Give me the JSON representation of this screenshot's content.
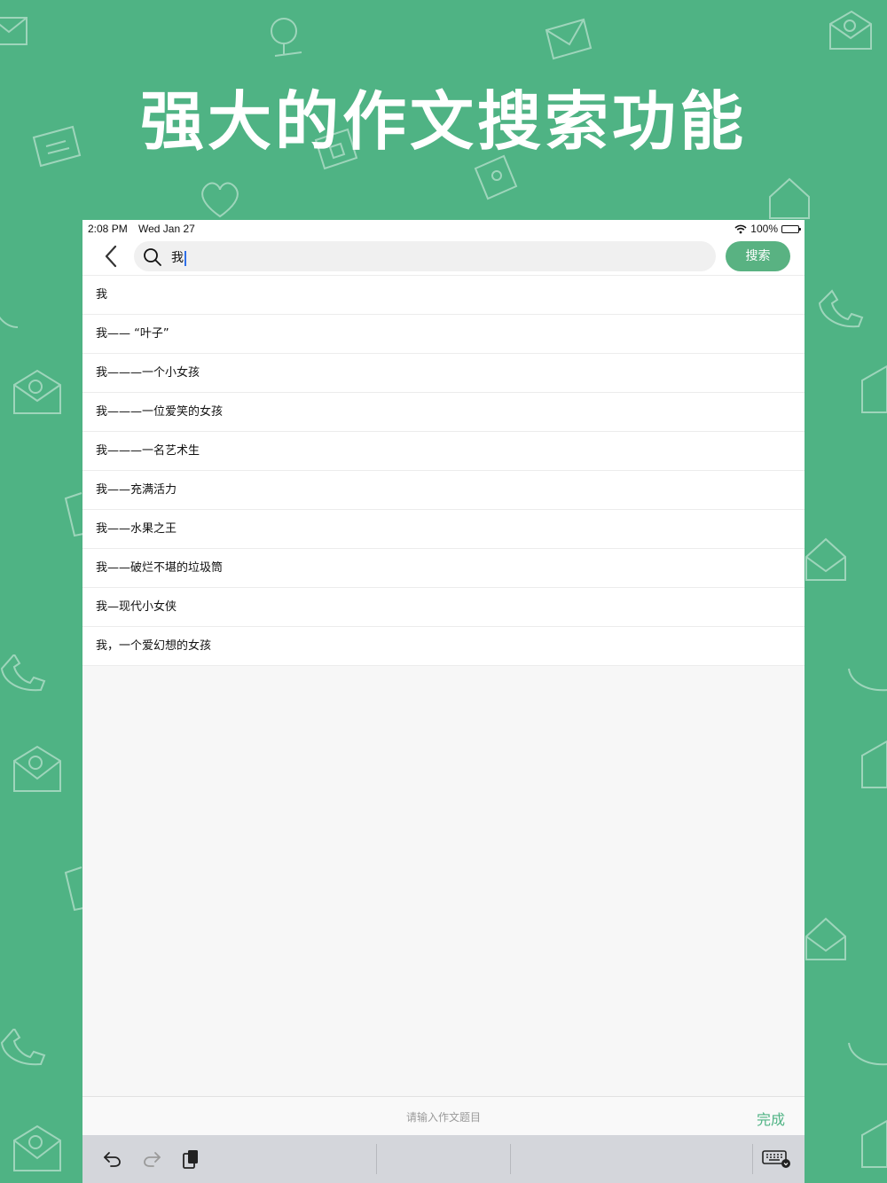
{
  "headline": "强大的作文搜索功能",
  "status_bar": {
    "time": "2:08 PM",
    "date": "Wed Jan 27",
    "battery_text": "100%",
    "battery_level": 1.0
  },
  "search": {
    "query": "我",
    "button_label": "搜索"
  },
  "results": [
    "我",
    "我—— “叶子”",
    "我———一个小女孩",
    "我———一位爱笑的女孩",
    "我———一名艺术生",
    "我——充满活力",
    "我——水果之王",
    "我——破烂不堪的垃圾筒",
    "我—现代小女侠",
    "我，一个爱幻想的女孩"
  ],
  "accessory": {
    "placeholder": "请输入作文题目",
    "done_label": "完成"
  },
  "colors": {
    "background": "#4fb384",
    "accent": "#59b282"
  }
}
